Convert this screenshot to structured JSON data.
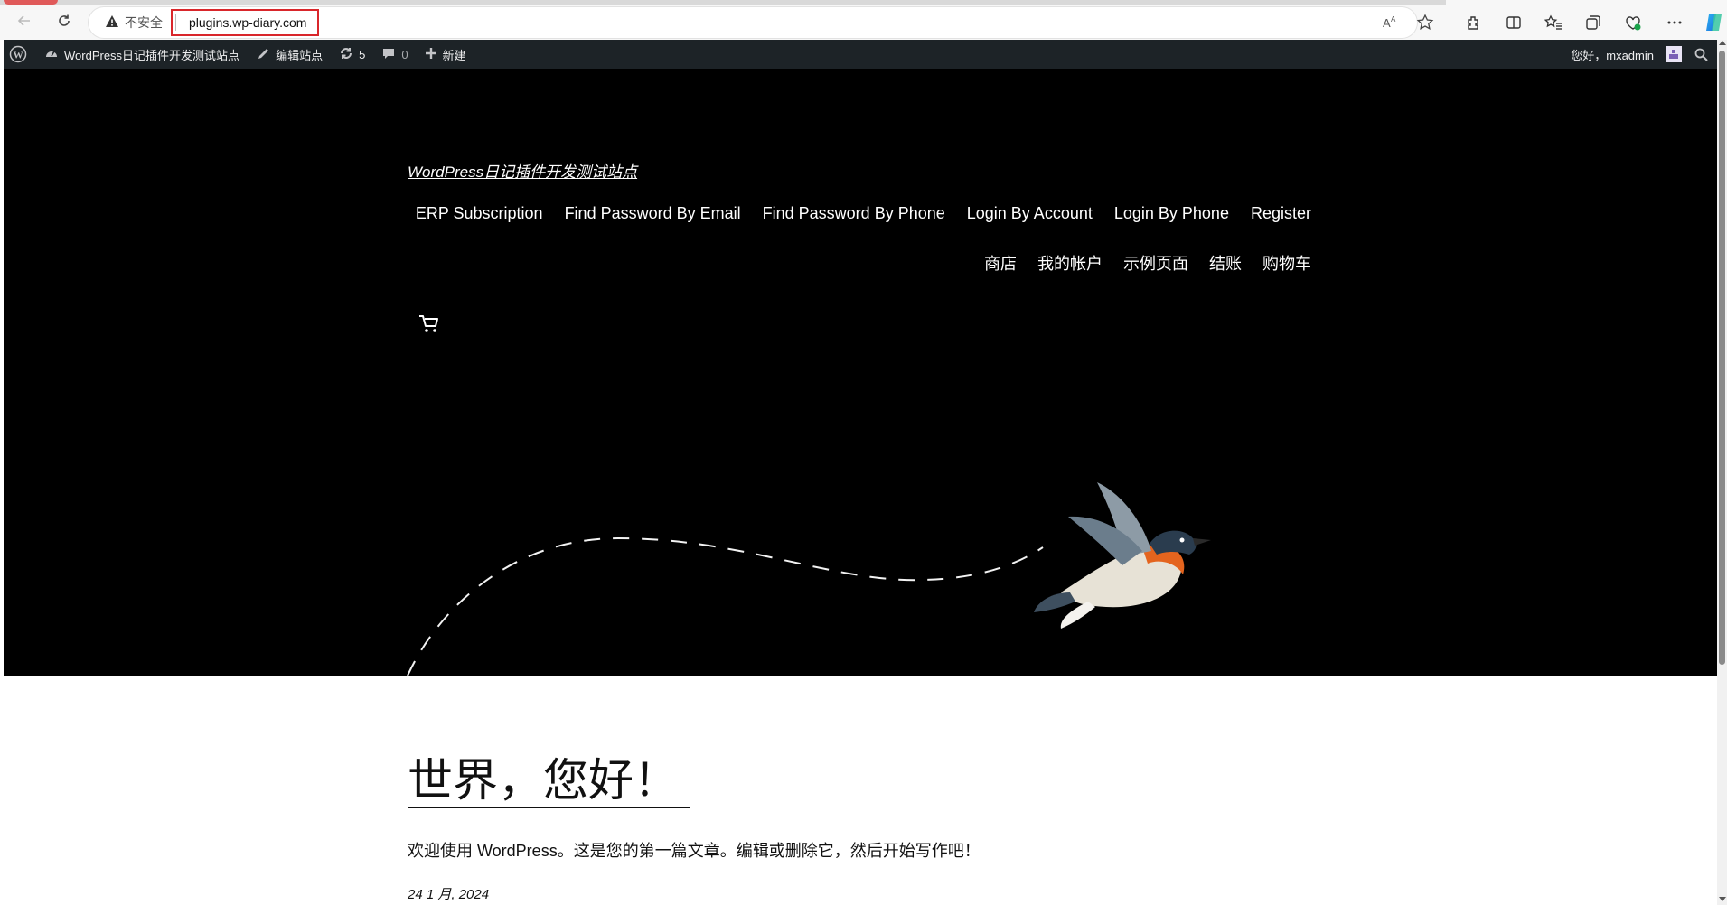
{
  "browser": {
    "security_label": "不安全",
    "url": "plugins.wp-diary.com",
    "icons": [
      "back-arrow-icon",
      "reload-icon",
      "warning-icon",
      "read-aloud-icon",
      "favorite-star-icon",
      "extensions-icon",
      "split-screen-icon",
      "favorites-list-icon",
      "collections-icon",
      "browser-essentials-icon",
      "more-menu-icon",
      "copilot-icon"
    ]
  },
  "adminbar": {
    "site_name": "WordPress日记插件开发测试站点",
    "edit_site": "编辑站点",
    "updates_count": "5",
    "comments_count": "0",
    "new_label": "新建",
    "greeting": "您好，mxadmin"
  },
  "site": {
    "title": "WordPress日记插件开发测试站点",
    "nav_row1": [
      "ERP Subscription",
      "Find Password By Email",
      "Find Password By Phone",
      "Login By Account",
      "Login By Phone",
      "Register"
    ],
    "nav_row2": [
      "商店",
      "我的帐户",
      "示例页面",
      "结账",
      "购物车"
    ]
  },
  "post": {
    "title": "世界，您好！",
    "excerpt": "欢迎使用 WordPress。这是您的第一篇文章。编辑或删除它，然后开始写作吧！",
    "date": "24 1 月, 2024"
  },
  "colors": {
    "adminbar_bg": "#1d2327",
    "header_bg": "#000000",
    "url_highlight": "#d9262b"
  }
}
